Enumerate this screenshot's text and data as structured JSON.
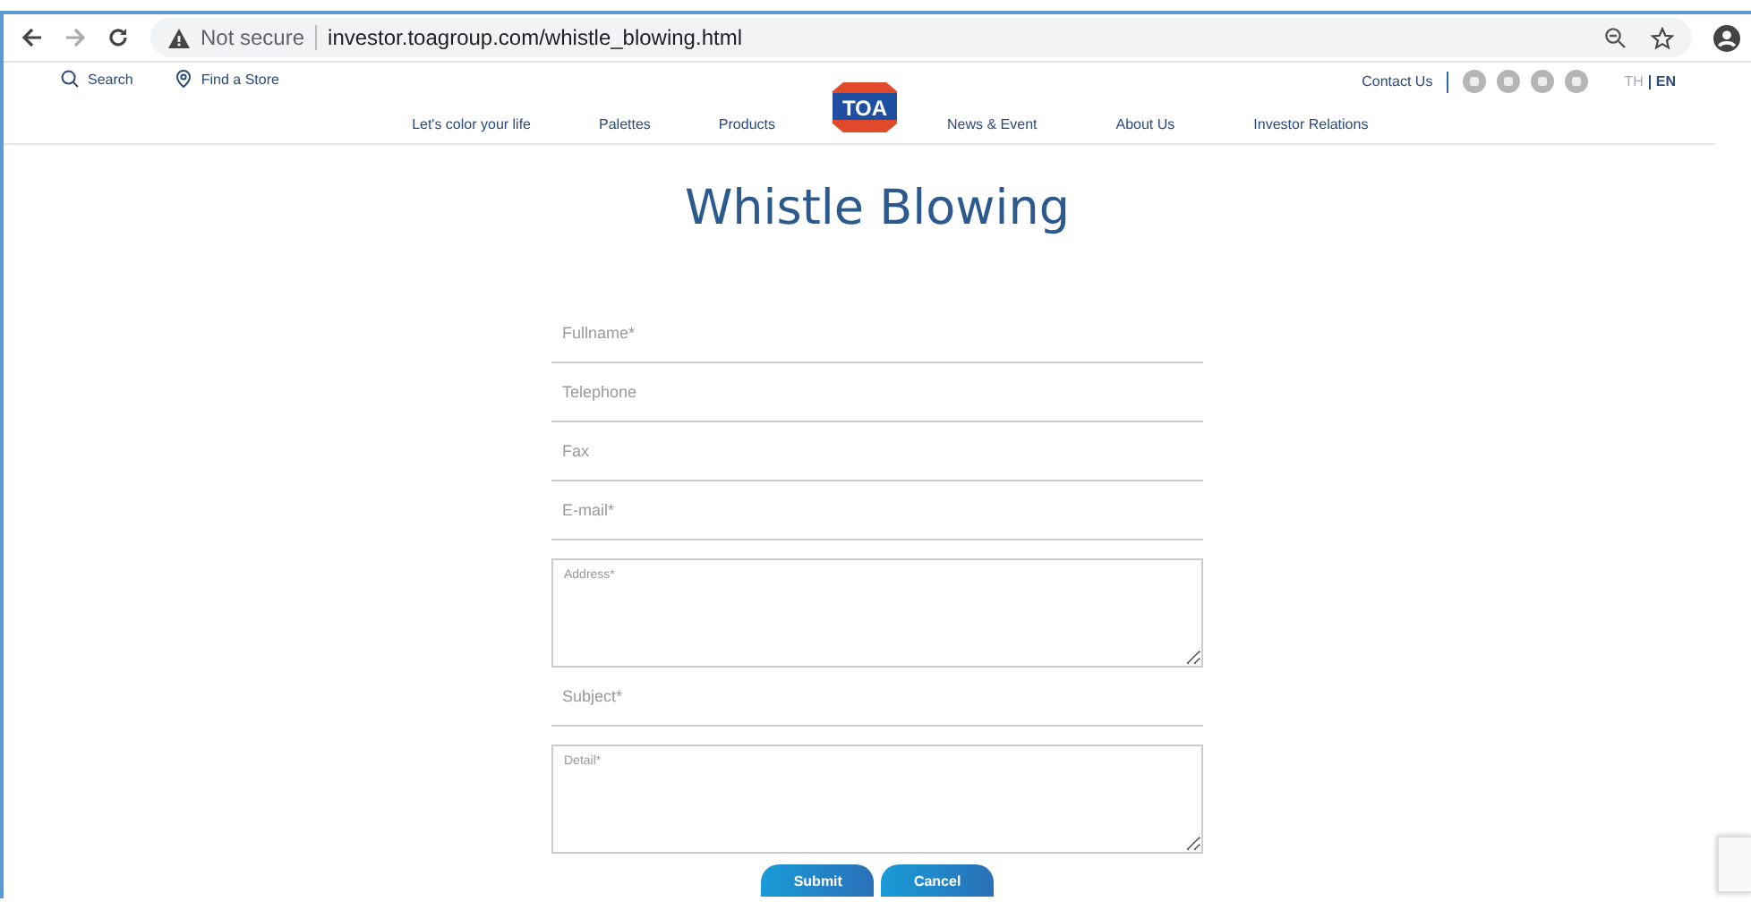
{
  "browser": {
    "security": "Not secure",
    "url": "investor.toagroup.com/whistle_blowing.html"
  },
  "header": {
    "utility_links": [
      "Search",
      "Find a Store"
    ],
    "contact": "Contact Us",
    "languages": [
      {
        "label": "TH",
        "selected": false
      },
      {
        "label": "EN",
        "selected": true
      }
    ],
    "logo": "TOA",
    "nav_left": [
      "Let's color your life",
      "Palettes",
      "Products"
    ],
    "nav_right": [
      "News & Event",
      "About Us",
      "Investor Relations"
    ]
  },
  "title": "Whistle Blowing",
  "form": {
    "fields": [
      {
        "kind": "line",
        "placeholder": "Fullname*"
      },
      {
        "kind": "line",
        "placeholder": "Telephone"
      },
      {
        "kind": "line",
        "placeholder": "Fax"
      },
      {
        "kind": "line",
        "placeholder": "E-mail*"
      },
      {
        "kind": "area",
        "placeholder": "Address*"
      },
      {
        "kind": "line",
        "placeholder": "Subject*"
      },
      {
        "kind": "area",
        "placeholder": "Detail*"
      }
    ],
    "buttons": [
      "Submit",
      "Cancel"
    ]
  }
}
